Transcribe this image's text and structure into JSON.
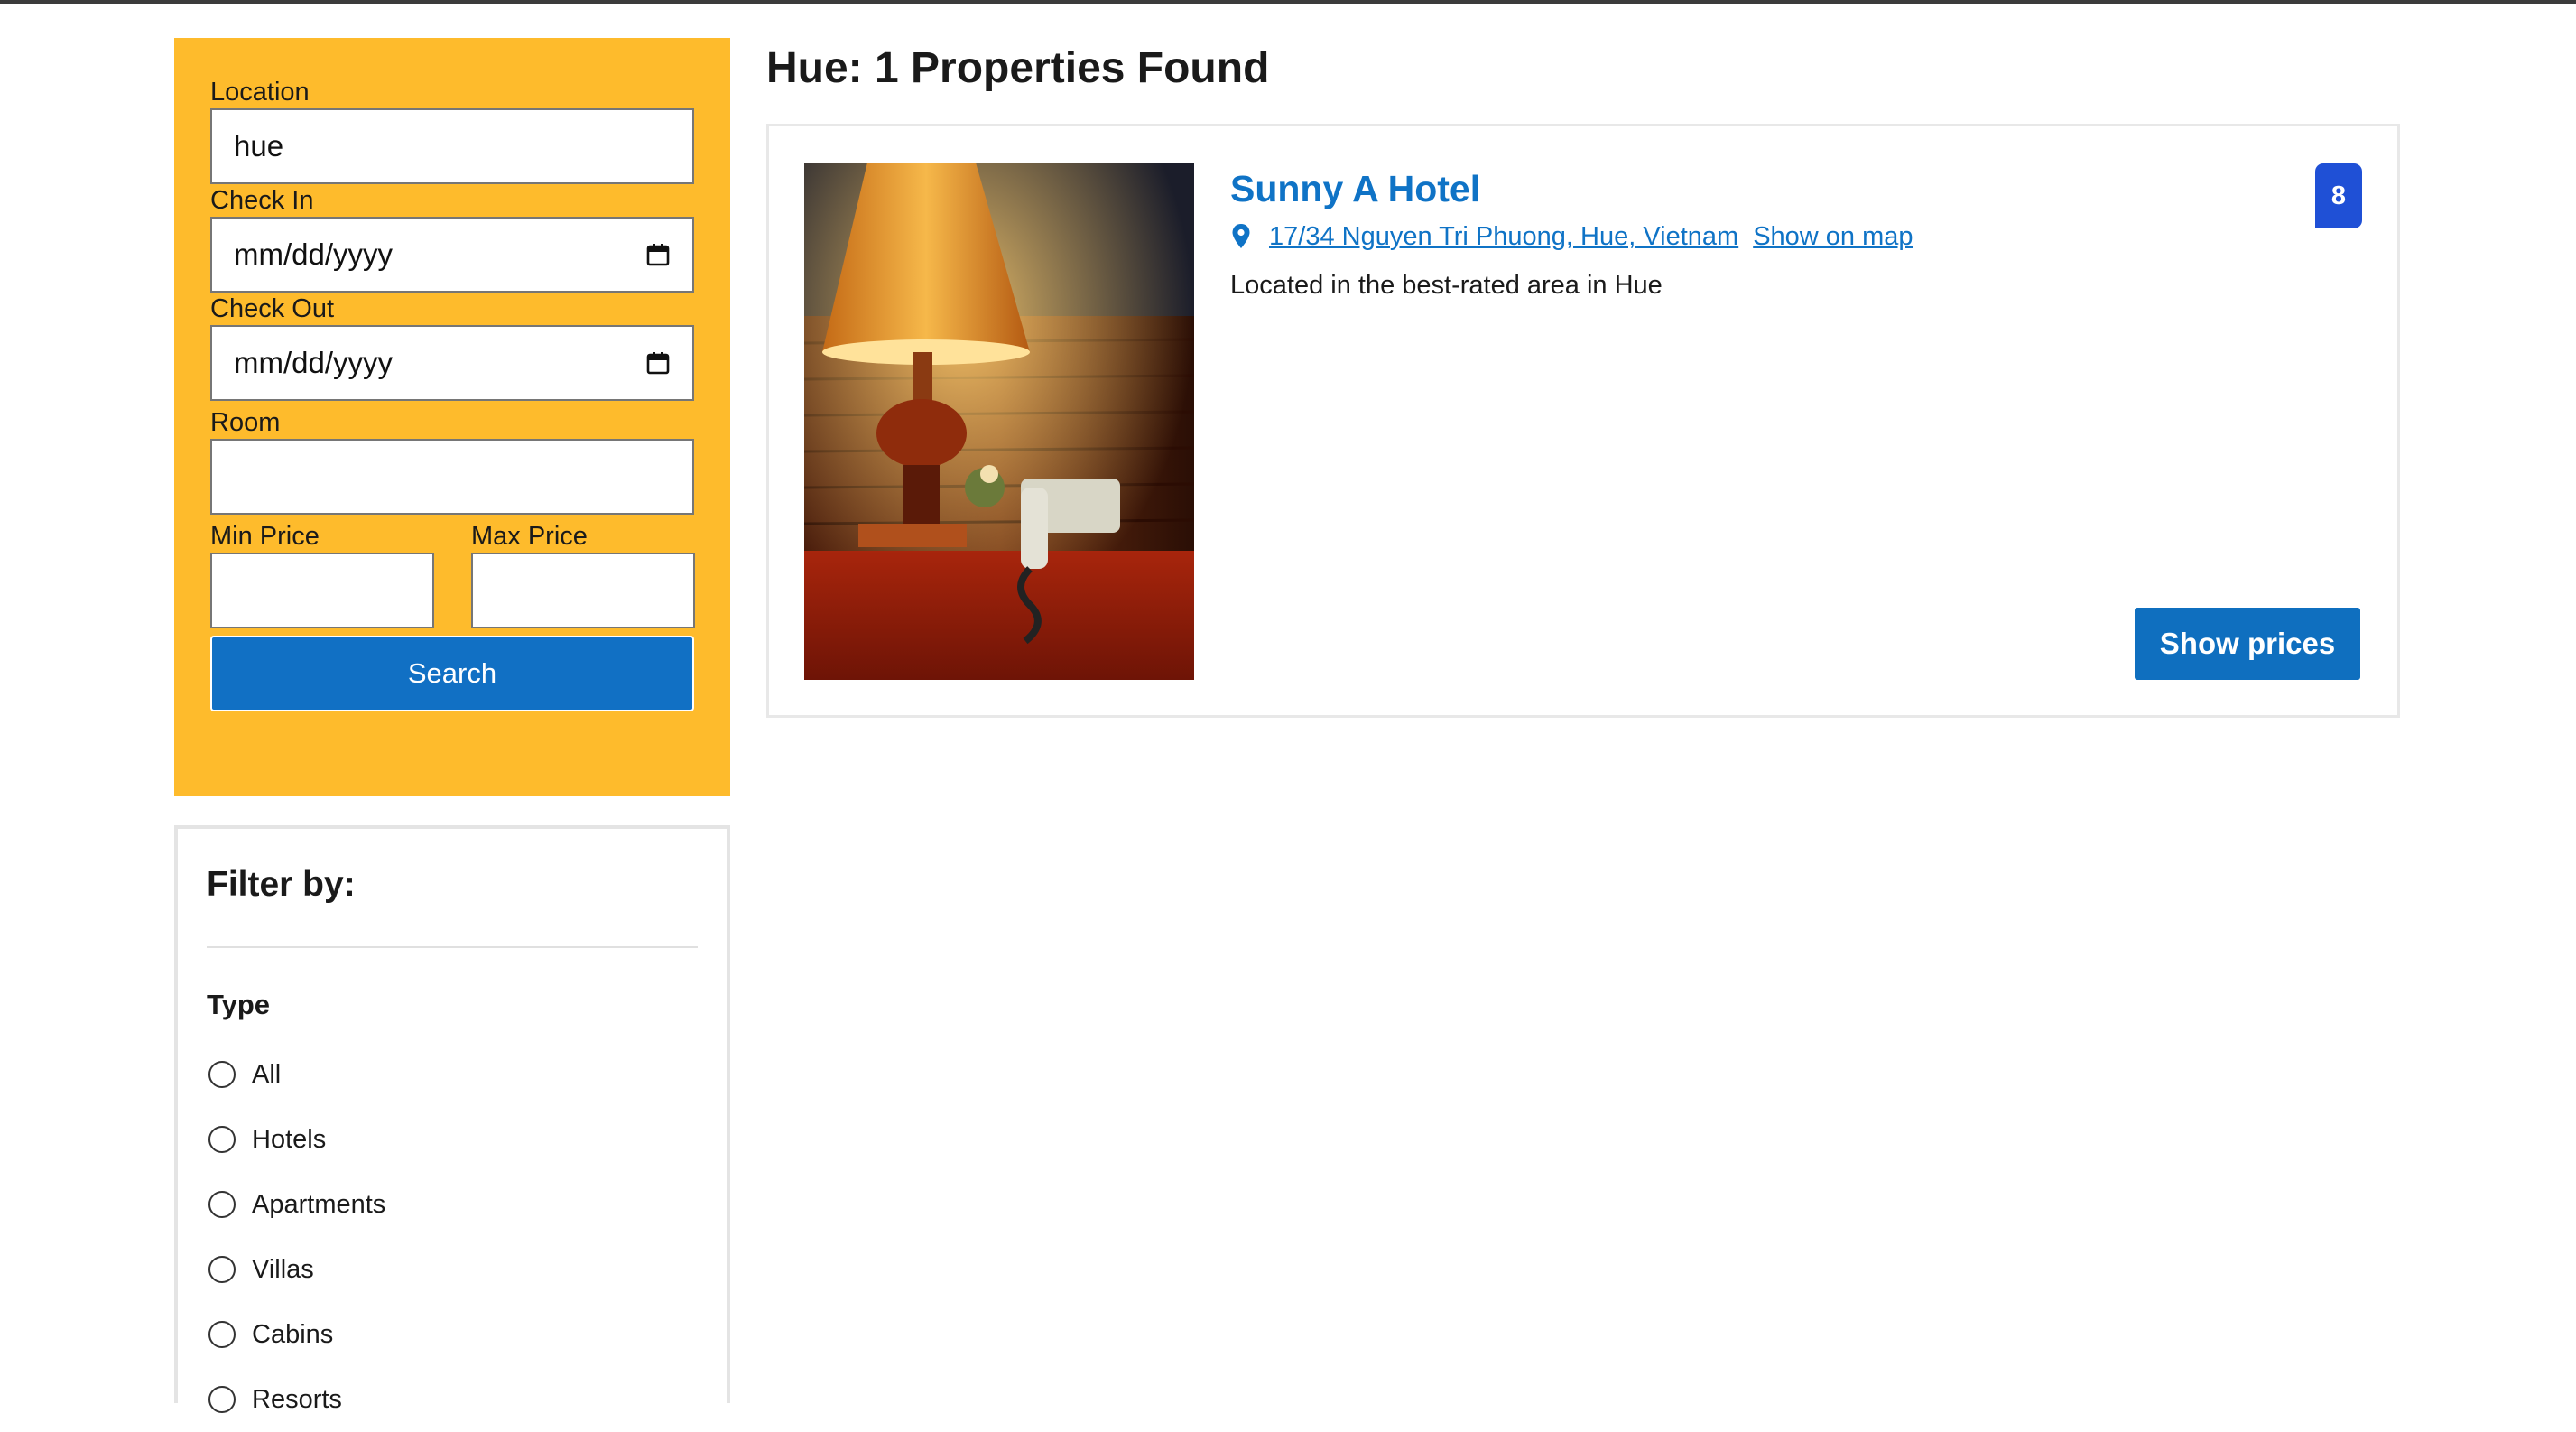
{
  "search": {
    "location_label": "Location",
    "location_value": "hue",
    "checkin_label": "Check In",
    "checkin_placeholder": "mm/dd/yyyy",
    "checkout_label": "Check Out",
    "checkout_placeholder": "mm/dd/yyyy",
    "room_label": "Room",
    "room_value": "",
    "min_price_label": "Min Price",
    "min_price_value": "",
    "max_price_label": "Max Price",
    "max_price_value": "",
    "search_button": "Search"
  },
  "filter": {
    "title": "Filter by:",
    "type_heading": "Type",
    "options": [
      "All",
      "Hotels",
      "Apartments",
      "Villas",
      "Cabins",
      "Resorts"
    ]
  },
  "results": {
    "title": "Hue: 1 Properties Found",
    "properties": [
      {
        "name": "Sunny A Hotel",
        "address": "17/34 Nguyen Tri Phuong, Hue, Vietnam",
        "map_link": "Show on map",
        "description": "Located in the best-rated area in Hue",
        "rating": "8",
        "cta": "Show prices"
      }
    ]
  },
  "icons": {
    "calendar": "calendar-icon",
    "location": "map-pin-icon"
  },
  "colors": {
    "search_panel_bg": "#febb2c",
    "primary_blue": "#1170c4",
    "link_blue": "#0f73c6",
    "rating_badge": "#1f50d6"
  }
}
